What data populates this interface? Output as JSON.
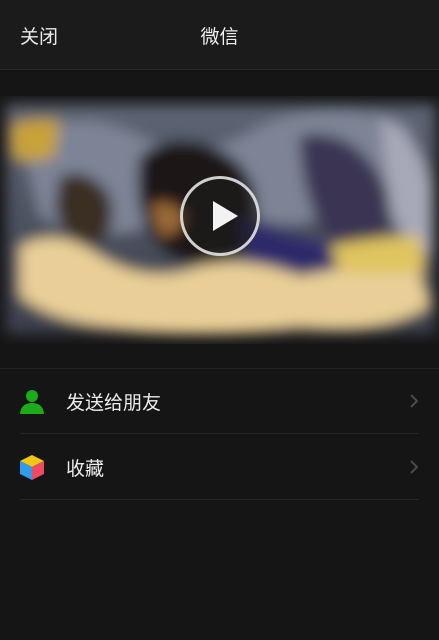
{
  "header": {
    "close_label": "关闭",
    "title": "微信"
  },
  "video": {
    "play_icon": "play-icon"
  },
  "menu": {
    "items": [
      {
        "label": "发送给朋友",
        "icon": "person-icon",
        "icon_color": "#1aad19"
      },
      {
        "label": "收藏",
        "icon": "cube-icon",
        "icon_color": "#f0c400"
      }
    ]
  },
  "colors": {
    "background": "#151515",
    "topbar": "#1b1b1b",
    "text": "#ececec",
    "divider": "#262626"
  }
}
